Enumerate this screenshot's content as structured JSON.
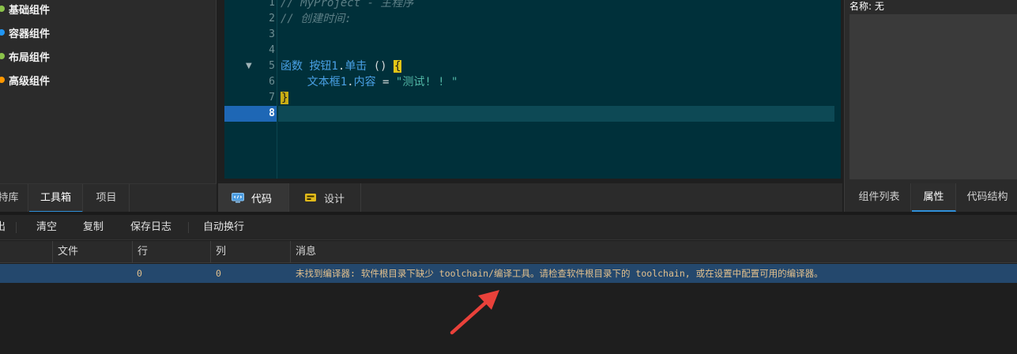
{
  "toolbox": {
    "categories": [
      {
        "label": "基础组件",
        "color": "#8bc34a"
      },
      {
        "label": "容器组件",
        "color": "#2196f3"
      },
      {
        "label": "布局组件",
        "color": "#8bc34a"
      },
      {
        "label": "高级组件",
        "color": "#ff9800"
      }
    ],
    "tabs": [
      "持库",
      "工具箱",
      "项目"
    ],
    "active_tab": "工具箱"
  },
  "editor": {
    "line_numbers": [
      "1",
      "2",
      "3",
      "4",
      "5",
      "6",
      "7",
      "8"
    ],
    "current_line": "8",
    "lines": {
      "l1": "// MyProject - 主程序",
      "l2": "// 创建时间:",
      "l5_keyword": "函数",
      "l5_object": "按钮1",
      "l5_dot": ".",
      "l5_event": "单击",
      "l5_parens": " () ",
      "l5_brace": "{",
      "l6_object": "文本框1",
      "l6_dot": ".",
      "l6_prop": "内容",
      "l6_eq": " = ",
      "l6_string": "\"测试! ! \"",
      "l7_brace": "}"
    },
    "tabs": [
      {
        "label": "代码",
        "icon": "code-monitor-icon"
      },
      {
        "label": "设计",
        "icon": "design-icon"
      }
    ],
    "active_tab": "代码"
  },
  "properties": {
    "name_label": "名称: 无",
    "tabs": [
      "组件列表",
      "属性",
      "代码结构"
    ],
    "active_tab": "属性"
  },
  "output": {
    "toolbar": [
      "出",
      "清空",
      "复制",
      "保存日志",
      "自动换行"
    ],
    "columns": [
      "",
      "文件",
      "行",
      "列",
      "消息"
    ],
    "rows": [
      {
        "type": "",
        "file": "",
        "line": "0",
        "col": "0",
        "message": "未找到编译器: 软件根目录下缺少 toolchain/编译工具。请检查软件根目录下的 toolchain, 或在设置中配置可用的编译器。"
      }
    ]
  },
  "colors": {
    "editor_bg": "#00303a",
    "selection_row": "#24486d",
    "accent_blue": "#2f8fd8",
    "arrow_red": "#e9413a",
    "error_text": "#e2c08d"
  }
}
